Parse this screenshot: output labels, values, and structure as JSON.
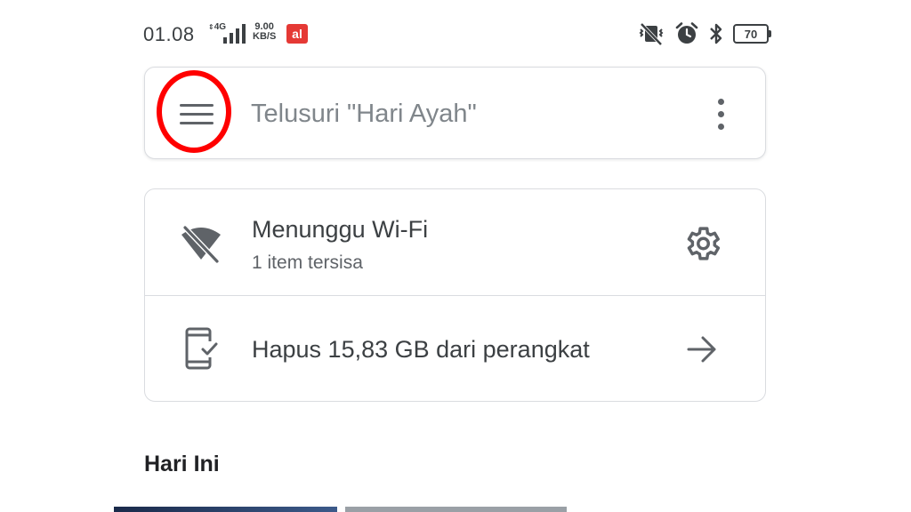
{
  "status_bar": {
    "time": "01.08",
    "network_type": "4G",
    "speed_value": "9.00",
    "speed_unit": "KB/S",
    "app_badge": "al",
    "battery": "70",
    "icons": [
      "vibrate-mute-icon",
      "alarm-icon",
      "bluetooth-icon",
      "battery-icon"
    ]
  },
  "search": {
    "placeholder": "Telusuri \"Hari Ayah\""
  },
  "backup_card": {
    "wifi_title": "Menunggu Wi-Fi",
    "wifi_subtitle": "1 item tersisa",
    "free_up_label": "Hapus 15,83 GB dari perangkat"
  },
  "section": {
    "title": "Hari Ini"
  },
  "colors": {
    "highlight_ring": "#ff0000",
    "text_primary": "#3c4043",
    "text_secondary": "#5f6368",
    "border": "#dadce0",
    "badge": "#e53935"
  }
}
